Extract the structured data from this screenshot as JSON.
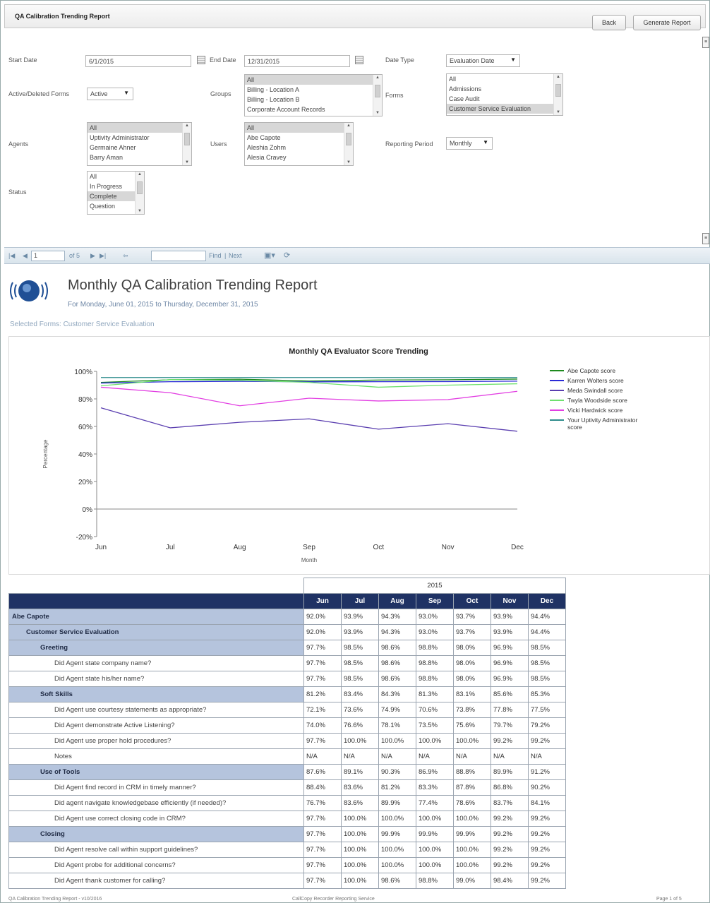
{
  "header": {
    "title": "QA Calibration Trending Report",
    "back_label": "Back",
    "generate_label": "Generate Report"
  },
  "filters": {
    "start_date_label": "Start Date",
    "start_date_value": "6/1/2015",
    "end_date_label": "End Date",
    "end_date_value": "12/31/2015",
    "date_type_label": "Date Type",
    "date_type_value": "Evaluation Date",
    "active_label": "Active/Deleted Forms",
    "active_value": "Active",
    "groups_label": "Groups",
    "groups_items": [
      "All",
      "Billing - Location A",
      "Billing - Location B",
      "Corporate Account Records"
    ],
    "forms_label": "Forms",
    "forms_items": [
      "All",
      "Admissions",
      "Case Audit",
      "Customer Service Evaluation"
    ],
    "agents_label": "Agents",
    "agents_items": [
      "All",
      "Uptivity Administrator",
      "Germaine Ahner",
      "Barry Aman"
    ],
    "users_label": "Users",
    "users_items": [
      "All",
      "Abe Capote",
      "Aleshia Zohm",
      "Alesia Cravey"
    ],
    "period_label": "Reporting Period",
    "period_value": "Monthly",
    "status_label": "Status",
    "status_items": [
      "All",
      "In Progress",
      "Complete",
      "Question"
    ]
  },
  "viewer": {
    "page_value": "1",
    "page_of": "of 5",
    "find_label": "Find",
    "next_label": "Next"
  },
  "report": {
    "title": "Monthly QA Calibration Trending Report",
    "subtitle": "For Monday, June 01, 2015 to Thursday, December 31, 2015",
    "selected_forms": "Selected Forms: Customer Service Evaluation"
  },
  "chart_data": {
    "type": "line",
    "title": "Monthly QA Evaluator Score Trending",
    "xlabel": "Month",
    "ylabel": "Percentage",
    "categories": [
      "Jun",
      "Jul",
      "Aug",
      "Sep",
      "Oct",
      "Nov",
      "Dec"
    ],
    "y_ticks": [
      "100%",
      "80%",
      "60%",
      "40%",
      "20%",
      "0%",
      "-20%"
    ],
    "ylim": [
      -20,
      100
    ],
    "grid": false,
    "legend": "right",
    "series": [
      {
        "name": "Abe Capote score",
        "color": "#1e8a1e",
        "values": [
          92.0,
          93.9,
          94.3,
          93.0,
          93.7,
          93.9,
          94.4
        ]
      },
      {
        "name": "Karren Wolters score",
        "color": "#2b2bd6",
        "values": [
          91.5,
          92.5,
          92.8,
          92.4,
          92.5,
          92.6,
          92.9
        ]
      },
      {
        "name": "Meda Swindall score",
        "color": "#5b3fb0",
        "values": [
          73.5,
          59.0,
          63.0,
          65.5,
          58.0,
          62.0,
          56.5
        ]
      },
      {
        "name": "Twyla Woodside score",
        "color": "#6ee06e",
        "values": [
          89.5,
          94.0,
          93.5,
          92.0,
          88.5,
          90.0,
          91.0
        ]
      },
      {
        "name": "Vicki Hardwick score",
        "color": "#e23ee2",
        "values": [
          88.5,
          84.5,
          75.0,
          80.5,
          78.5,
          79.5,
          85.5
        ]
      },
      {
        "name": "Your Uptivity Administrator score",
        "color": "#2e8b8b",
        "values": [
          95.5,
          95.5,
          95.5,
          95.5,
          95.5,
          95.5,
          95.5
        ]
      }
    ]
  },
  "table": {
    "year": "2015",
    "months": [
      "Jun",
      "Jul",
      "Aug",
      "Sep",
      "Oct",
      "Nov",
      "Dec"
    ],
    "rows": [
      {
        "level": 0,
        "label": "Abe Capote",
        "values": [
          "92.0%",
          "93.9%",
          "94.3%",
          "93.0%",
          "93.7%",
          "93.9%",
          "94.4%"
        ]
      },
      {
        "level": 1,
        "label": "Customer Service Evaluation",
        "values": [
          "92.0%",
          "93.9%",
          "94.3%",
          "93.0%",
          "93.7%",
          "93.9%",
          "94.4%"
        ]
      },
      {
        "level": 2,
        "label": "Greeting",
        "values": [
          "97.7%",
          "98.5%",
          "98.6%",
          "98.8%",
          "98.0%",
          "96.9%",
          "98.5%"
        ]
      },
      {
        "level": 3,
        "label": "Did Agent state company name?",
        "values": [
          "97.7%",
          "98.5%",
          "98.6%",
          "98.8%",
          "98.0%",
          "96.9%",
          "98.5%"
        ]
      },
      {
        "level": 3,
        "label": "Did Agent state his/her name?",
        "values": [
          "97.7%",
          "98.5%",
          "98.6%",
          "98.8%",
          "98.0%",
          "96.9%",
          "98.5%"
        ]
      },
      {
        "level": 2,
        "label": "Soft Skills",
        "values": [
          "81.2%",
          "83.4%",
          "84.3%",
          "81.3%",
          "83.1%",
          "85.6%",
          "85.3%"
        ]
      },
      {
        "level": 3,
        "label": "Did Agent use courtesy statements as appropriate?",
        "values": [
          "72.1%",
          "73.6%",
          "74.9%",
          "70.6%",
          "73.8%",
          "77.8%",
          "77.5%"
        ]
      },
      {
        "level": 3,
        "label": "Did Agent demonstrate Active Listening?",
        "values": [
          "74.0%",
          "76.6%",
          "78.1%",
          "73.5%",
          "75.6%",
          "79.7%",
          "79.2%"
        ]
      },
      {
        "level": 3,
        "label": "Did Agent use proper hold procedures?",
        "values": [
          "97.7%",
          "100.0%",
          "100.0%",
          "100.0%",
          "100.0%",
          "99.2%",
          "99.2%"
        ]
      },
      {
        "level": 3,
        "label": "Notes",
        "values": [
          "N/A",
          "N/A",
          "N/A",
          "N/A",
          "N/A",
          "N/A",
          "N/A"
        ]
      },
      {
        "level": 2,
        "label": "Use of Tools",
        "values": [
          "87.6%",
          "89.1%",
          "90.3%",
          "86.9%",
          "88.8%",
          "89.9%",
          "91.2%"
        ]
      },
      {
        "level": 3,
        "label": "Did Agent find record in CRM in timely manner?",
        "values": [
          "88.4%",
          "83.6%",
          "81.2%",
          "83.3%",
          "87.8%",
          "86.8%",
          "90.2%"
        ]
      },
      {
        "level": 3,
        "label": "Did agent navigate knowledgebase efficiently (if needed)?",
        "values": [
          "76.7%",
          "83.6%",
          "89.9%",
          "77.4%",
          "78.6%",
          "83.7%",
          "84.1%"
        ]
      },
      {
        "level": 3,
        "label": "Did Agent use correct closing code in CRM?",
        "values": [
          "97.7%",
          "100.0%",
          "100.0%",
          "100.0%",
          "100.0%",
          "99.2%",
          "99.2%"
        ]
      },
      {
        "level": 2,
        "label": "Closing",
        "values": [
          "97.7%",
          "100.0%",
          "99.9%",
          "99.9%",
          "99.9%",
          "99.2%",
          "99.2%"
        ]
      },
      {
        "level": 3,
        "label": "Did Agent resolve call within support guidelines?",
        "values": [
          "97.7%",
          "100.0%",
          "100.0%",
          "100.0%",
          "100.0%",
          "99.2%",
          "99.2%"
        ]
      },
      {
        "level": 3,
        "label": "Did Agent probe for additional concerns?",
        "values": [
          "97.7%",
          "100.0%",
          "100.0%",
          "100.0%",
          "100.0%",
          "99.2%",
          "99.2%"
        ]
      },
      {
        "level": 3,
        "label": "Did Agent thank customer for calling?",
        "values": [
          "97.7%",
          "100.0%",
          "98.6%",
          "98.8%",
          "99.0%",
          "98.4%",
          "99.2%"
        ]
      }
    ]
  },
  "footer": {
    "left": "QA Calibration Trending Report - v10/2016",
    "center": "CallCopy Recorder Reporting Service",
    "right": "Page 1 of 5"
  }
}
